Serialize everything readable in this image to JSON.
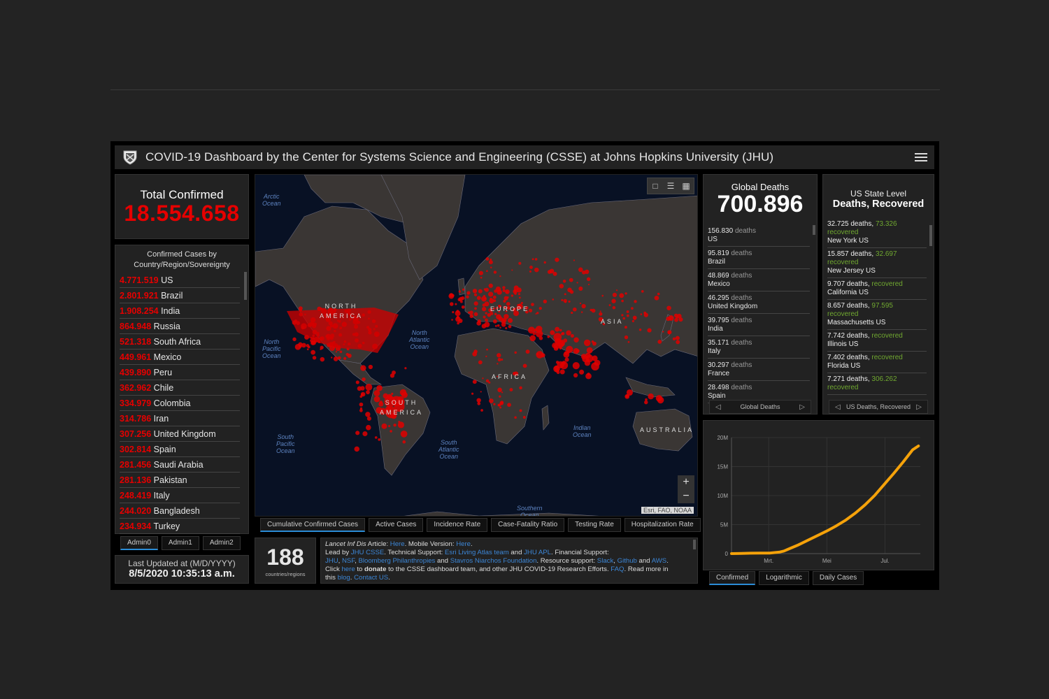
{
  "header": {
    "title": "COVID-19 Dashboard by the Center for Systems Science and Engineering (CSSE) at Johns Hopkins University (JHU)"
  },
  "total_confirmed": {
    "label": "Total Confirmed",
    "value": "18.554.658"
  },
  "country_list": {
    "heading_line1": "Confirmed Cases by",
    "heading_line2": "Country/Region/Sovereignty",
    "items": [
      {
        "value": "4.771.519",
        "name": "US"
      },
      {
        "value": "2.801.921",
        "name": "Brazil"
      },
      {
        "value": "1.908.254",
        "name": "India"
      },
      {
        "value": "864.948",
        "name": "Russia"
      },
      {
        "value": "521.318",
        "name": "South Africa"
      },
      {
        "value": "449.961",
        "name": "Mexico"
      },
      {
        "value": "439.890",
        "name": "Peru"
      },
      {
        "value": "362.962",
        "name": "Chile"
      },
      {
        "value": "334.979",
        "name": "Colombia"
      },
      {
        "value": "314.786",
        "name": "Iran"
      },
      {
        "value": "307.256",
        "name": "United Kingdom"
      },
      {
        "value": "302.814",
        "name": "Spain"
      },
      {
        "value": "281.456",
        "name": "Saudi Arabia"
      },
      {
        "value": "281.136",
        "name": "Pakistan"
      },
      {
        "value": "248.419",
        "name": "Italy"
      },
      {
        "value": "244.020",
        "name": "Bangladesh"
      },
      {
        "value": "234.934",
        "name": "Turkey"
      }
    ]
  },
  "admin_tabs": [
    "Admin0",
    "Admin1",
    "Admin2"
  ],
  "admin_tab_active": "Admin0",
  "last_updated": {
    "label": "Last Updated at (M/D/YYYY)",
    "value": "8/5/2020 10:35:13 a.m."
  },
  "map": {
    "ocean_labels": [
      {
        "id": "arctic",
        "l1": "Arctic",
        "l2": "Ocean"
      },
      {
        "id": "npacific",
        "l1": "North",
        "l2": "Pacific",
        "l3": "Ocean"
      },
      {
        "id": "natlantic",
        "l1": "North",
        "l2": "Atlantic",
        "l3": "Ocean"
      },
      {
        "id": "spacific",
        "l1": "South",
        "l2": "Pacific",
        "l3": "Ocean"
      },
      {
        "id": "satlantic",
        "l1": "South",
        "l2": "Atlantic",
        "l3": "Ocean"
      },
      {
        "id": "indian",
        "l1": "Indian",
        "l2": "Ocean"
      },
      {
        "id": "southern",
        "l1": "Southern",
        "l2": "Ocean"
      }
    ],
    "continent_labels": {
      "north_america_1": "NORTH",
      "north_america_2": "AMERICA",
      "south_america_1": "SOUTH",
      "south_america_2": "AMERICA",
      "europe": "EUROPE",
      "asia": "ASIA",
      "africa": "AFRICA",
      "australia": "AUSTRALIA"
    },
    "attribution": "Esri, FAO, NOAA",
    "zoom_in": "+",
    "zoom_out": "−",
    "tools": [
      "bookmark-icon",
      "legend-list-icon",
      "basemap-gallery-icon"
    ]
  },
  "map_tabs": [
    "Cumulative Confirmed Cases",
    "Active Cases",
    "Incidence Rate",
    "Case-Fatality Ratio",
    "Testing Rate",
    "Hospitalization Rate"
  ],
  "map_tab_active": "Cumulative Confirmed Cases",
  "countries_count": {
    "value": "188",
    "label": "countries/regions"
  },
  "info": {
    "l1_article": "Lancet Inf Dis",
    "l1_text1": " Article: ",
    "l1_link1": "Here",
    "l1_text2": ". Mobile Version: ",
    "l1_link2": "Here",
    "l1_text3": ".",
    "l2_text1": "Lead by ",
    "l2_link1": "JHU CSSE",
    "l2_text2": ". Technical Support: ",
    "l2_link2": "Esri Living Atlas team",
    "l2_text3": " and ",
    "l2_link3": "JHU APL",
    "l2_text4": ". Financial Support:",
    "l3_link1": "JHU",
    "l3_link2": "NSF",
    "l3_link3": "Bloomberg Philanthropies",
    "l3_text1": " and ",
    "l3_link4": "Stavros Niarchos Foundation",
    "l3_text2": ". Resource support: ",
    "l3_link5": "Slack",
    "l3_link6": "Github",
    "l3_text3": " and ",
    "l3_link7": "AWS",
    "l4_text1": "Click ",
    "l4_link1": "here",
    "l4_text2": " to ",
    "l4_bold": "donate",
    "l4_text3": " to the CSSE dashboard team, and other JHU COVID-19 Research Efforts. ",
    "l4_link2": "FAQ",
    "l4_text4": ". Read more in",
    "l5_text1": "this ",
    "l5_link1": "blog",
    "l5_link2": "Contact US"
  },
  "global_deaths": {
    "label": "Global Deaths",
    "value": "700.896",
    "word": "deaths",
    "items": [
      {
        "value": "156.830",
        "name": "US"
      },
      {
        "value": "95.819",
        "name": "Brazil"
      },
      {
        "value": "48.869",
        "name": "Mexico"
      },
      {
        "value": "46.295",
        "name": "United Kingdom"
      },
      {
        "value": "39.795",
        "name": "India"
      },
      {
        "value": "35.171",
        "name": "Italy"
      },
      {
        "value": "30.297",
        "name": "France"
      },
      {
        "value": "28.498",
        "name": "Spain"
      }
    ],
    "pager_label": "Global Deaths"
  },
  "us_deaths": {
    "label1": "US State Level",
    "label2": "Deaths, Recovered",
    "items": [
      {
        "deaths": "32.725 deaths,",
        "recovered_num": "73.326",
        "recovered_word": "recovered",
        "name": "New York US"
      },
      {
        "deaths": "15.857 deaths,",
        "recovered_num": "32.697",
        "recovered_word": "recovered",
        "name": "New Jersey US"
      },
      {
        "deaths": "9.707 deaths,",
        "recovered_num": "",
        "recovered_word": "recovered",
        "name": "California US"
      },
      {
        "deaths": "8.657 deaths,",
        "recovered_num": "97.595",
        "recovered_word": "recovered",
        "name": "Massachusetts US"
      },
      {
        "deaths": "7.742 deaths,",
        "recovered_num": "",
        "recovered_word": "recovered",
        "name": "Illinois US"
      },
      {
        "deaths": "7.402 deaths,",
        "recovered_num": "",
        "recovered_word": "recovered",
        "name": "Florida US"
      },
      {
        "deaths": "7.271 deaths,",
        "recovered_num": "306.262",
        "recovered_word": "recovered",
        "name": ""
      }
    ],
    "pager_label": "US Deaths, Recovered"
  },
  "chart_tabs": [
    "Confirmed",
    "Logarithmic",
    "Daily Cases"
  ],
  "chart_tab_active": "Confirmed",
  "colors": {
    "confirmed_red": "#e60000",
    "recovered_green": "#70a830",
    "link_blue": "#3c86d6",
    "chart_line": "#f5a20a",
    "tab_active_underline": "#2b8cd6"
  },
  "chart_data": {
    "type": "line",
    "title": "",
    "xlabel": "",
    "ylabel": "",
    "x_tick_labels": [
      "Mrt.",
      "Mei",
      "Jul."
    ],
    "x_tick_days": [
      39,
      100,
      161
    ],
    "y_tick_labels": [
      "0",
      "5M",
      "10M",
      "15M",
      "20M"
    ],
    "y_ticks": [
      0,
      5000000,
      10000000,
      15000000,
      20000000
    ],
    "ylim": [
      0,
      20000000
    ],
    "xlim_days": [
      0,
      198
    ],
    "grid": true,
    "series": [
      {
        "name": "Confirmed",
        "x_days": [
          0,
          10,
          20,
          30,
          40,
          50,
          55,
          60,
          70,
          80,
          90,
          100,
          110,
          120,
          130,
          140,
          150,
          160,
          170,
          180,
          190,
          196
        ],
        "values": [
          1000,
          40000,
          75000,
          80000,
          90000,
          250000,
          450000,
          800000,
          1500000,
          2300000,
          3100000,
          3900000,
          4800000,
          5800000,
          7000000,
          8400000,
          10000000,
          11900000,
          13800000,
          15800000,
          17900000,
          18554658
        ]
      }
    ]
  }
}
